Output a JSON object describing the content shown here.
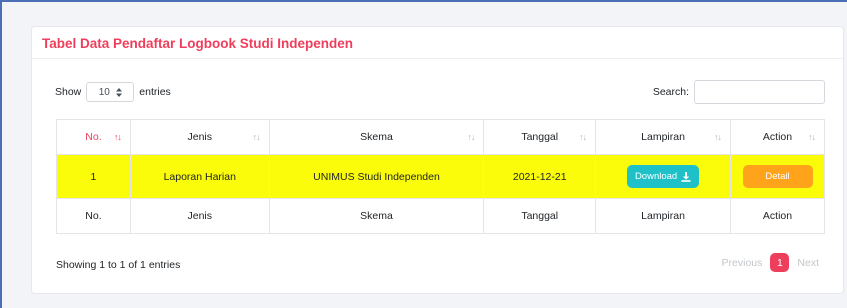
{
  "card": {
    "title": "Tabel Data Pendaftar Logbook Studi Independen"
  },
  "length_control": {
    "prefix": "Show",
    "selected": "10",
    "suffix": "entries"
  },
  "search": {
    "label": "Search:",
    "value": ""
  },
  "table": {
    "headers": [
      "No.",
      "Jenis",
      "Skema",
      "Tanggal",
      "Lampiran",
      "Action"
    ],
    "rows": [
      {
        "no": "1",
        "jenis": "Laporan Harian",
        "skema": "UNIMUS Studi Independen",
        "tanggal": "2021-12-21",
        "download_label": "Download",
        "detail_label": "Detail"
      }
    ],
    "footer": [
      "No.",
      "Jenis",
      "Skema",
      "Tanggal",
      "Lampiran",
      "Action"
    ]
  },
  "info": "Showing 1 to 1 of 1 entries",
  "pagination": {
    "previous": "Previous",
    "current": "1",
    "next": "Next"
  },
  "colors": {
    "title": "#ee3e5b",
    "highlight_row": "#fbfc09",
    "download_button": "#1fc1c8",
    "detail_button": "#fea31a",
    "active_page": "#ee3e5b"
  }
}
